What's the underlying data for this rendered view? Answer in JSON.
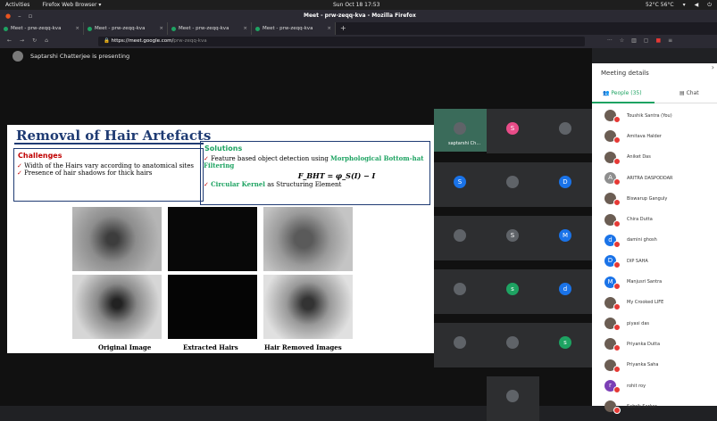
{
  "os_bar": {
    "activities": "Activities",
    "app": "Firefox Web Browser ▾",
    "clock": "Sun Oct 18 17:53",
    "tray": "52°C  56°C"
  },
  "window": {
    "title": "Meet - prw-zeqq-kva - Mozilla Firefox"
  },
  "tabs": [
    {
      "label": "Meet - prw-zeqq-kva"
    },
    {
      "label": "Meet - prw-zeqq-kva"
    },
    {
      "label": "Meet - prw-zeqq-kva"
    },
    {
      "label": "Meet - prw-zeqq-kva"
    }
  ],
  "url": {
    "host": "https://meet.google.com/",
    "path": "prw-zeqq-kva"
  },
  "presenter": {
    "text": "Saptarshi Chatterjee is presenting"
  },
  "slide": {
    "title": "Removal of Hair Artefacts",
    "challenges_heading": "Challenges",
    "challenges": [
      "Width of the Hairs vary according to anatomical sites",
      "Presence of hair shadows for thick hairs"
    ],
    "solutions_heading": "Solutions",
    "sol1_text": "Feature based object detection using ",
    "sol1_highlight": "Morphological Bottom-hat Filtering",
    "formula": "F_BHT = φ_S(I) − I",
    "sol2_highlight": "Circular Kernel",
    "sol2_text": " as Structuring Element",
    "captions": [
      "Original Image",
      "Extracted Hairs",
      "Hair Removed Images"
    ]
  },
  "grid_tiles": [
    {
      "letter": "",
      "color": "#5f6368",
      "label": "saptarshi Ch..."
    },
    {
      "letter": "S",
      "color": "#e84c88"
    },
    {
      "letter": "",
      "color": "#5f6368"
    },
    {
      "letter": "S",
      "color": "#1a73e8"
    },
    {
      "letter": "",
      "color": "#5f6368"
    },
    {
      "letter": "D",
      "color": "#1a73e8"
    },
    {
      "letter": "",
      "color": "#5f6368"
    },
    {
      "letter": "S",
      "color": "#5f6368"
    },
    {
      "letter": "M",
      "color": "#1a73e8"
    },
    {
      "letter": "",
      "color": "#5f6368"
    },
    {
      "letter": "s",
      "color": "#1ea362"
    },
    {
      "letter": "d",
      "color": "#1a73e8"
    },
    {
      "letter": "",
      "color": "#5f6368"
    },
    {
      "letter": "",
      "color": "#5f6368"
    },
    {
      "letter": "s",
      "color": "#1ea362"
    },
    {
      "letter": "",
      "color": "#5f6368"
    }
  ],
  "panel": {
    "title": "Meeting details",
    "tab_people": "People (35)",
    "tab_chat": "Chat",
    "people": [
      {
        "name": "Toushik Santra (You)",
        "avatar": "photo"
      },
      {
        "name": "Amitava Halder",
        "avatar": "photo"
      },
      {
        "name": "Aniket Das",
        "avatar": "photo"
      },
      {
        "name": "ARITRA DASPODDAR",
        "avatar": "A",
        "color": "#8e8e8e"
      },
      {
        "name": "Biswarup Ganguly",
        "avatar": "photo"
      },
      {
        "name": "Chira Dutta",
        "avatar": "photo"
      },
      {
        "name": "damini ghosh",
        "avatar": "d",
        "color": "#1a73e8"
      },
      {
        "name": "DIP SAHA",
        "avatar": "D",
        "color": "#1a73e8"
      },
      {
        "name": "Manjusri Santra",
        "avatar": "M",
        "color": "#1a73e8"
      },
      {
        "name": "My Crooked LIFE",
        "avatar": "photo"
      },
      {
        "name": "piyasi das",
        "avatar": "photo"
      },
      {
        "name": "Priyanka Dutta",
        "avatar": "photo"
      },
      {
        "name": "Priyanka Saha",
        "avatar": "photo"
      },
      {
        "name": "rohit roy",
        "avatar": "r",
        "color": "#7b3fb5"
      },
      {
        "name": "Sabrik Sarkar",
        "avatar": "photo"
      }
    ]
  }
}
